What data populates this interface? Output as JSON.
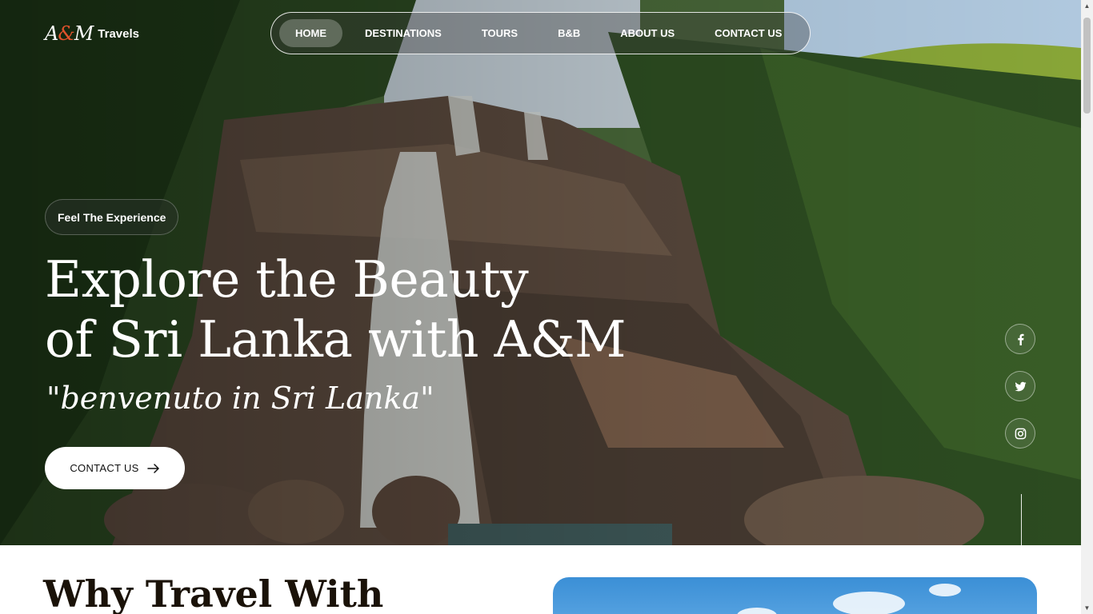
{
  "brand": {
    "logo_letters": "A&M",
    "name": "Travels"
  },
  "nav": {
    "items": [
      {
        "label": "HOME",
        "active": true
      },
      {
        "label": "DESTINATIONS",
        "active": false
      },
      {
        "label": "TOURS",
        "active": false
      },
      {
        "label": "B&B",
        "active": false
      },
      {
        "label": "ABOUT US",
        "active": false
      },
      {
        "label": "CONTACT US",
        "active": false
      }
    ]
  },
  "hero": {
    "tagline": "Feel The Experience",
    "headline_line1": "Explore the Beauty",
    "headline_line2": "of Sri Lanka with A&M",
    "subline": "\"benvenuto in Sri Lanka\"",
    "cta_label": "CONTACT US",
    "cta_icon": "arrow-right-icon"
  },
  "social": [
    {
      "name": "facebook-icon"
    },
    {
      "name": "twitter-icon"
    },
    {
      "name": "instagram-icon"
    }
  ],
  "why_section": {
    "title": "Why Travel With"
  },
  "colors": {
    "heading_dark": "#1a1208",
    "logo_accent": "#e0522b",
    "cta_bg": "#ffffff"
  }
}
